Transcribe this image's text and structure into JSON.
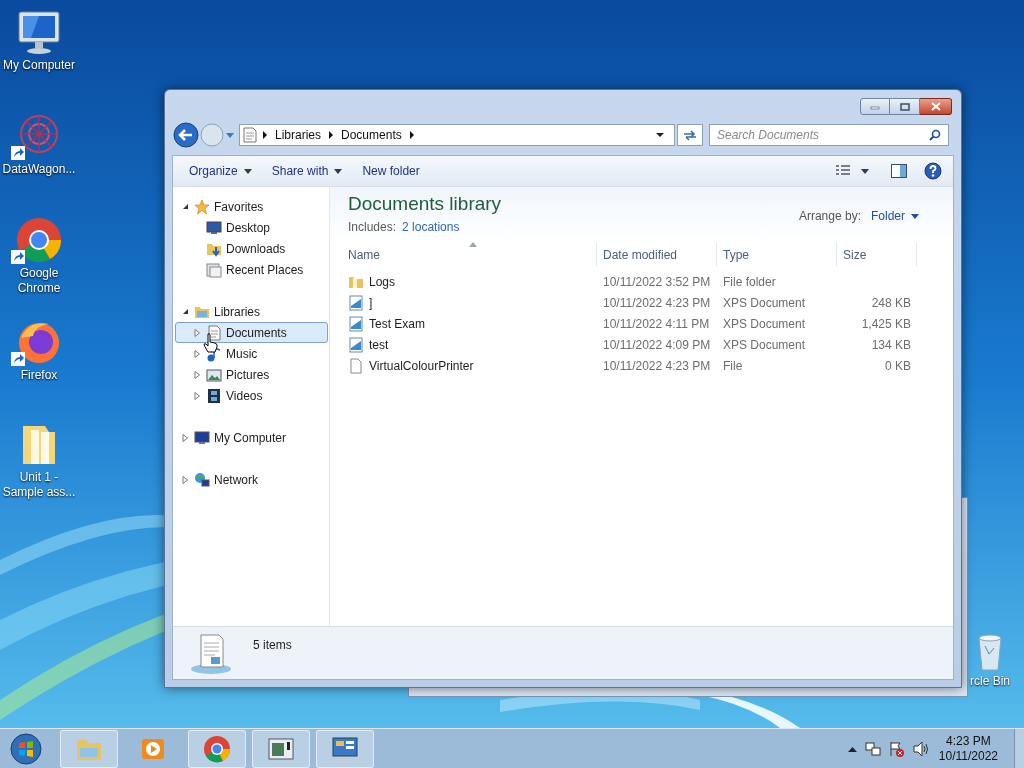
{
  "desktop_icons": [
    {
      "label": "My Computer",
      "kind": "computer",
      "shortcut": false
    },
    {
      "label": "DataWagon...",
      "kind": "datawagon",
      "shortcut": true
    },
    {
      "label": "Google Chrome",
      "kind": "chrome",
      "shortcut": true
    },
    {
      "label": "Firefox",
      "kind": "firefox",
      "shortcut": true
    },
    {
      "label": "Unit 1 - Sample ass...",
      "kind": "folder",
      "shortcut": false
    }
  ],
  "recycle_bin": {
    "label": "rcle Bin"
  },
  "explorer": {
    "address_path": [
      "Libraries",
      "Documents"
    ],
    "search": {
      "placeholder": "Search Documents"
    },
    "toolbar": [
      {
        "label": "Organize",
        "has_menu": true
      },
      {
        "label": "Share with",
        "has_menu": true
      },
      {
        "label": "New folder",
        "has_menu": false
      }
    ],
    "nav_tree": [
      {
        "label": "Favorites",
        "kind": "star",
        "expanded": true,
        "selected": false,
        "children": [
          {
            "label": "Desktop",
            "kind": "desktop",
            "selected": false
          },
          {
            "label": "Downloads",
            "kind": "downloads",
            "selected": false
          },
          {
            "label": "Recent Places",
            "kind": "recent",
            "selected": false
          }
        ]
      },
      {
        "label": "Libraries",
        "kind": "libraries",
        "expanded": true,
        "selected": false,
        "children": [
          {
            "label": "Documents",
            "kind": "documents",
            "expanded": false,
            "selected": true
          },
          {
            "label": "Music",
            "kind": "music",
            "expanded": false,
            "selected": false
          },
          {
            "label": "Pictures",
            "kind": "pictures",
            "expanded": false,
            "selected": false
          },
          {
            "label": "Videos",
            "kind": "videos",
            "expanded": false,
            "selected": false
          }
        ]
      },
      {
        "label": "My Computer",
        "kind": "computer",
        "expanded": false,
        "selected": false
      },
      {
        "label": "Network",
        "kind": "network",
        "expanded": false,
        "selected": false
      }
    ],
    "library_title": "Documents library",
    "includes_label": "Includes:",
    "includes_link": "2 locations",
    "arrange_label": "Arrange by:",
    "arrange_value": "Folder",
    "columns": [
      {
        "label": "Name",
        "sorted": true
      },
      {
        "label": "Date modified",
        "sorted": false
      },
      {
        "label": "Type",
        "sorted": false
      },
      {
        "label": "Size",
        "sorted": false
      }
    ],
    "rows": [
      {
        "kind": "folder",
        "name": "Logs",
        "date": "10/11/2022 3:52 PM",
        "type": "File folder"
      },
      {
        "kind": "xps",
        "name": "]",
        "date": "10/11/2022 4:23 PM",
        "type": "XPS Document",
        "size": "248 KB"
      },
      {
        "kind": "xps",
        "name": "Test Exam",
        "date": "10/11/2022 4:11 PM",
        "type": "XPS Document",
        "size": "1,425 KB"
      },
      {
        "kind": "xps",
        "name": "test",
        "date": "10/11/2022 4:09 PM",
        "type": "XPS Document",
        "size": "134 KB"
      },
      {
        "kind": "file",
        "name": "VirtualColourPrinter",
        "date": "10/11/2022 4:23 PM",
        "type": "File",
        "size": "0 KB"
      }
    ],
    "status": "5 items"
  },
  "taskbar": {
    "apps": [
      {
        "kind": "explorer",
        "active": true
      },
      {
        "kind": "media",
        "active": false
      },
      {
        "kind": "chrome",
        "active": true
      },
      {
        "kind": "app",
        "active": true
      },
      {
        "kind": "control",
        "active": true
      }
    ],
    "time": "4:23 PM",
    "date": "10/11/2022"
  }
}
